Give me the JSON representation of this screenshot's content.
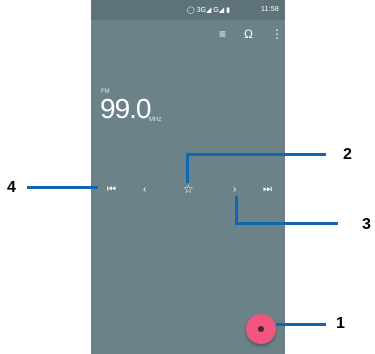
{
  "status_bar": {
    "icons": "◯ 3G◢ G◢ ▮",
    "time": "11:58"
  },
  "toolbar": {
    "list_icon": "≡",
    "headset_icon": "Ω",
    "more_icon": "⋮"
  },
  "tuner": {
    "band": "FM",
    "frequency": "99.0",
    "unit": "MHz"
  },
  "controls": {
    "prev_station": "⏮",
    "seek_back": "‹",
    "favorite": "☆",
    "seek_forward": "›",
    "next_station": "⏭"
  },
  "annotations": {
    "n1": "1",
    "n2": "2",
    "n3": "3",
    "n4": "4"
  }
}
